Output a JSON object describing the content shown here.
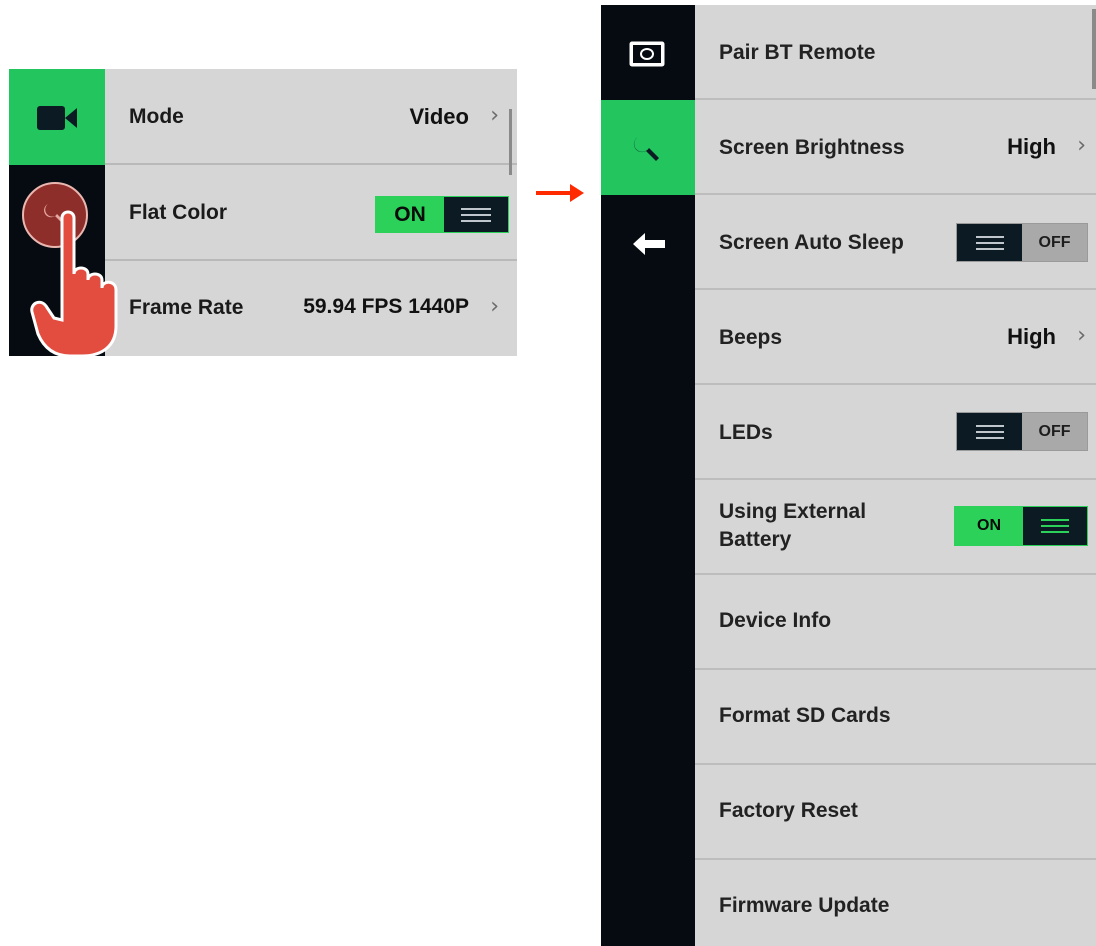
{
  "left_panel": {
    "rows": [
      {
        "label": "Mode",
        "value": "Video"
      },
      {
        "label": "Flat Color",
        "toggle": "ON"
      },
      {
        "label": "Frame Rate",
        "value": "59.94 FPS 1440P"
      }
    ],
    "sidebar_icons": [
      "video-camera-icon",
      "wrench-icon"
    ],
    "pointer_icon": "pointing-hand-icon"
  },
  "arrow_icon": "right-arrow-icon",
  "right_panel": {
    "sidebar_icons": [
      "camera-icon",
      "wrench-icon",
      "back-arrow-icon"
    ],
    "rows": [
      {
        "label": "Pair BT Remote"
      },
      {
        "label": "Screen Brightness",
        "value": "High"
      },
      {
        "label": "Screen Auto Sleep",
        "toggle": "OFF"
      },
      {
        "label": "Beeps",
        "value": "High"
      },
      {
        "label": "LEDs",
        "toggle": "OFF"
      },
      {
        "label_line1": "Using External",
        "label_line2": "Battery",
        "toggle": "ON"
      },
      {
        "label": "Device Info"
      },
      {
        "label": "Format SD Cards"
      },
      {
        "label": "Factory Reset"
      },
      {
        "label": "Firmware Update"
      }
    ]
  },
  "colors": {
    "accent_green": "#22c55e",
    "sidebar_black": "#050b10",
    "panel_gray": "#d6d6d6",
    "pointer_red": "#e34d3f",
    "arrow_red": "#ff2a00"
  }
}
